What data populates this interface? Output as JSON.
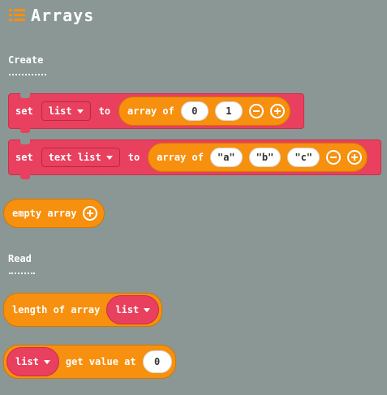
{
  "header": {
    "title": "Arrays",
    "icon": "list-icon"
  },
  "sections": {
    "create": "Create",
    "read": "Read"
  },
  "blocks": {
    "set_list": {
      "set_label": "set",
      "var": "list",
      "to_label": "to",
      "array_label": "array of",
      "values": [
        "0",
        "1"
      ]
    },
    "set_text_list": {
      "set_label": "set",
      "var": "text list",
      "to_label": "to",
      "array_label": "array of",
      "values": [
        "\"a\"",
        "\"b\"",
        "\"c\""
      ]
    },
    "empty_array": {
      "label": "empty array"
    },
    "length_of_array": {
      "label": "length of array",
      "var": "list"
    },
    "get_value": {
      "var": "list",
      "label": "get value at",
      "value": "0"
    }
  },
  "colors": {
    "background": "#8a9794",
    "array_orange": "#f6900e",
    "variable_red": "#e8405e",
    "header_icon_orange": "#f6900e"
  }
}
